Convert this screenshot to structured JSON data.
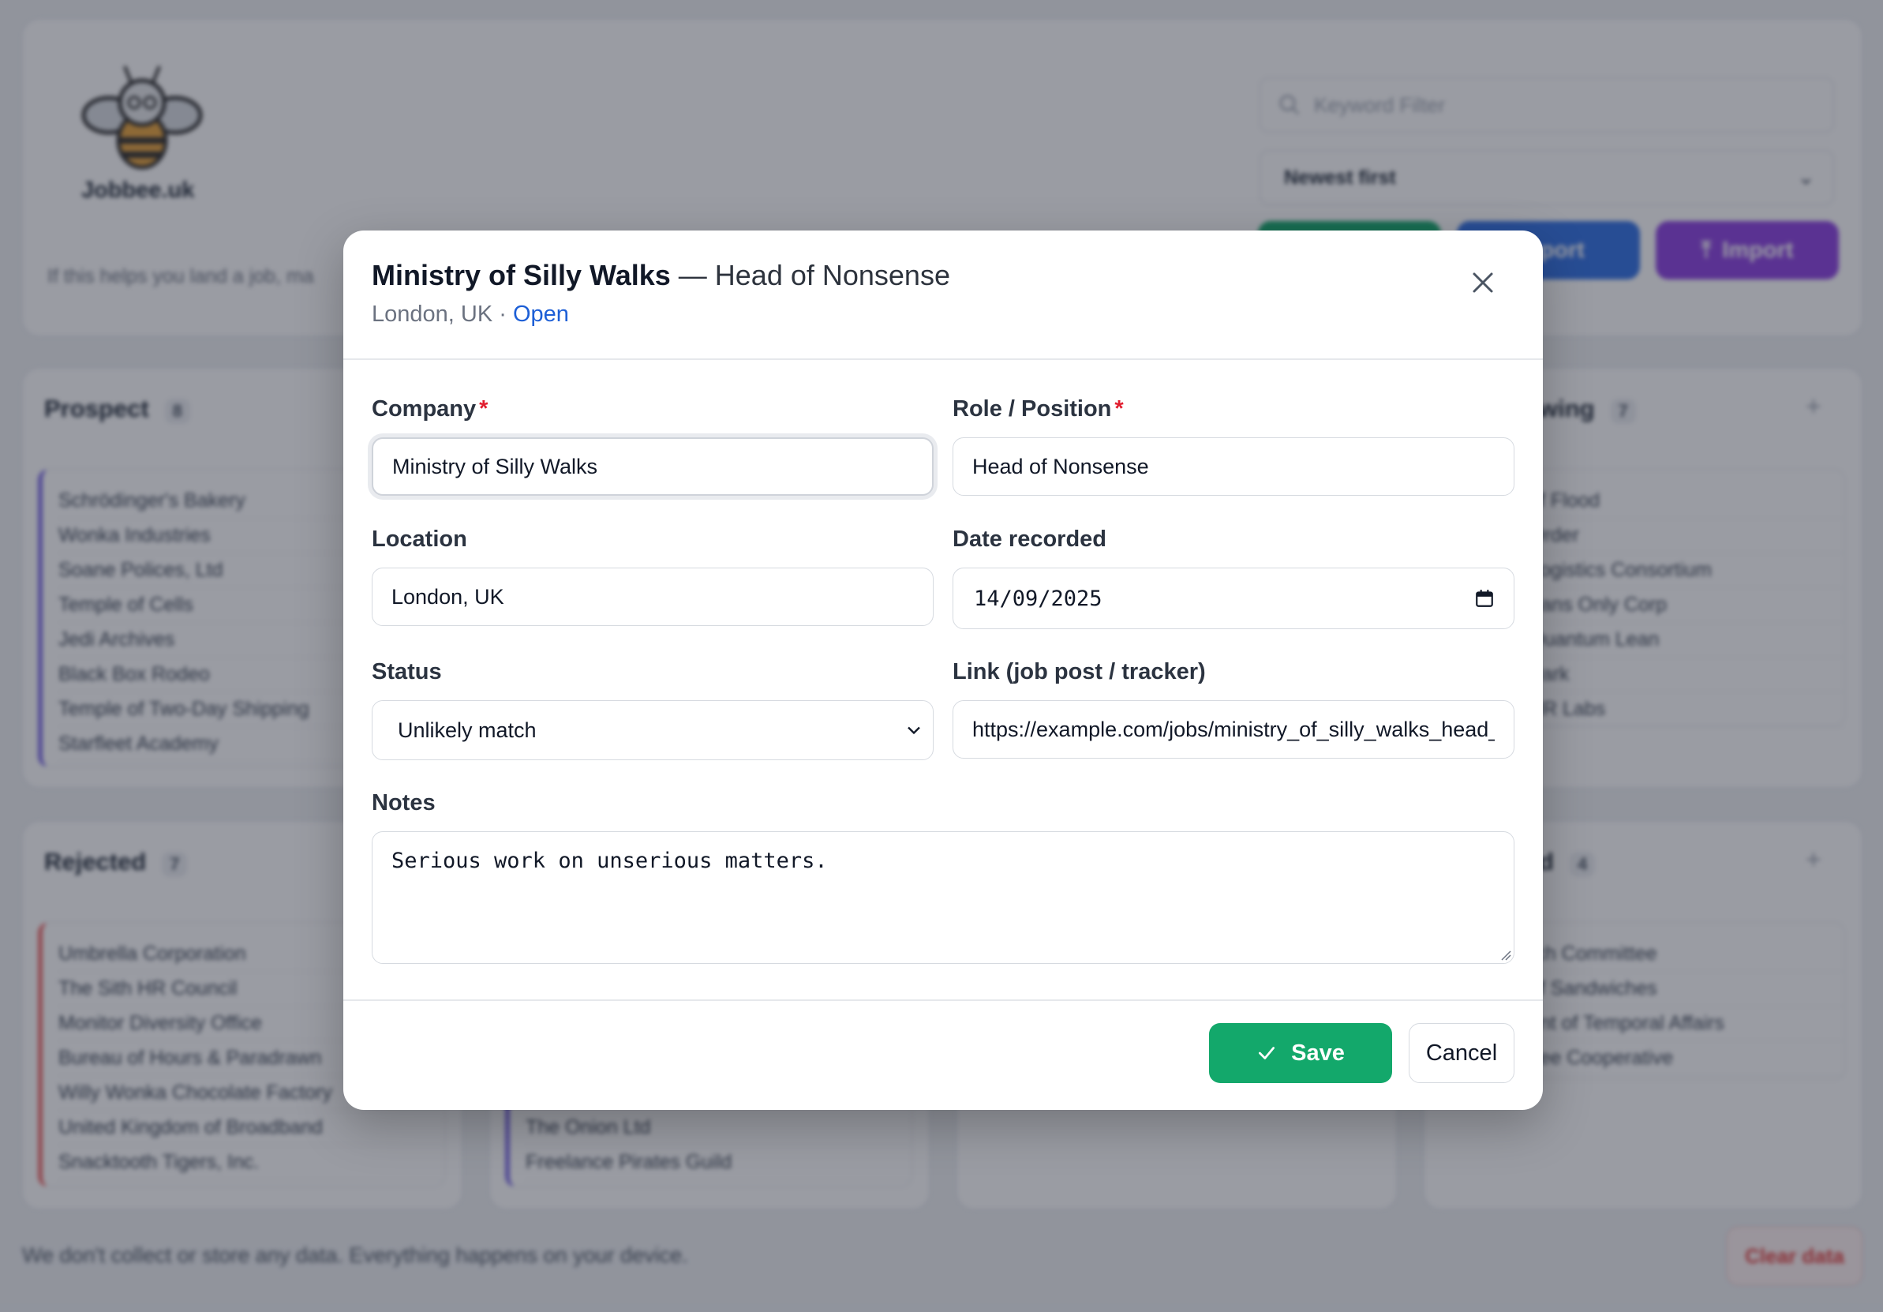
{
  "background": {
    "brand": "Jobbee.uk",
    "tagline": "If this helps you land a job, ma",
    "keyword_filter_placeholder": "Keyword Filter",
    "sort_selected": "Newest first",
    "export_label": "Export",
    "import_label": "Import",
    "columns": [
      {
        "title": "Prospect",
        "count": "8",
        "accent": "#7c6be6",
        "items": [
          "Schrödinger's Bakery",
          "Wonka Industries",
          "Soane Polices, Ltd",
          "Temple of Cells",
          "Jedi Archives",
          "Black Box Rodeo",
          "Temple of Two-Day Shipping",
          "Starfleet Academy"
        ]
      },
      {
        "title": "wing",
        "count": "7",
        "items": [
          "of Flood",
          "Order",
          "Logistics Consortium",
          "Fans Only Corp",
          "Quantum Lean",
          "Park",
          "HR Labs"
        ]
      },
      {
        "title": "Rejected",
        "count": "7",
        "accent": "#ef6a6a",
        "items": [
          "Umbrella Corporation",
          "The Sith HR Council",
          "Monitor Diversity Office",
          "Bureau of Hours & Paradrawn",
          "Willy Wonka Chocolate Factory",
          "United Kingdom of Broadband",
          "Snacktooth Tigers, Inc."
        ]
      },
      {
        "title": "d",
        "count": "4",
        "items": [
          "rch Committee",
          "of Sandwiches",
          "ent of Temporal Affairs",
          "ffee Cooperative"
        ]
      }
    ],
    "middle_items": [
      "The Onion Ltd",
      "Freelance Pirates Guild"
    ],
    "footer_note": "We don't collect or store any data. Everything happens on your device.",
    "clear_label": "Clear data"
  },
  "modal": {
    "title_company": "Ministry of Silly Walks",
    "title_separator": " — ",
    "title_role": "Head of Nonsense",
    "subtitle_location": "London, UK",
    "subtitle_dot": " · ",
    "subtitle_status": "Open",
    "company_label": "Company",
    "company_value": "Ministry of Silly Walks",
    "role_label": "Role / Position",
    "role_value": "Head of Nonsense",
    "required_mark": "*",
    "location_label": "Location",
    "location_value": "London, UK",
    "date_label": "Date recorded",
    "date_value": "14/09/2025",
    "status_label": "Status",
    "status_value": "Unlikely match",
    "link_label": "Link (job post / tracker)",
    "link_value": "https://example.com/jobs/ministry_of_silly_walks_head_",
    "notes_label": "Notes",
    "notes_value": "Serious work on unserious matters.",
    "save_label": "Save",
    "cancel_label": "Cancel"
  },
  "colors": {
    "save": "#13a86b",
    "open_link": "#1d5fd6",
    "required": "#e11d2e",
    "import": "#8b3fe0",
    "export": "#2f6fe4"
  }
}
